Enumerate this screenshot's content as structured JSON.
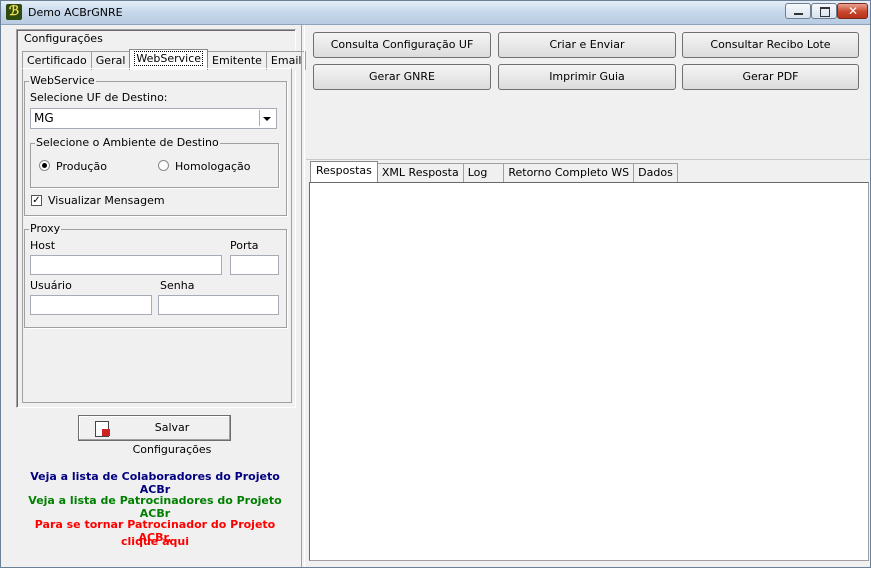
{
  "window": {
    "title": "Demo ACBrGNRE",
    "app_icon": "acbr-app-icon"
  },
  "config": {
    "legend": "Configurações",
    "tabs": [
      "Certificado",
      "Geral",
      "WebService",
      "Emitente",
      "Email"
    ],
    "active_tab": "WebService",
    "webservice": {
      "legend": "WebService",
      "uf_label": "Selecione UF de Destino:",
      "uf_value": "MG",
      "ambiente_legend": "Selecione o Ambiente de Destino",
      "producao_label": "Produção",
      "homologacao_label": "Homologação",
      "selected_ambiente": "Produção",
      "visualizar_label": "Visualizar Mensagem",
      "visualizar_checked": true
    },
    "proxy": {
      "legend": "Proxy",
      "host_label": "Host",
      "porta_label": "Porta",
      "usuario_label": "Usuário",
      "senha_label": "Senha",
      "host_value": "",
      "porta_value": "",
      "usuario_value": "",
      "senha_value": ""
    },
    "save_label": "Salvar Configurações"
  },
  "links": {
    "colaboradores": "Veja a lista de Colaboradores do Projeto ACBr",
    "patrocinadores": "Veja a lista de Patrocinadores do Projeto ACBr",
    "tornar_line1": "Para se tornar Patrocinador do Projeto ACBr,",
    "tornar_line2": "clique aqui",
    "colors": {
      "colaboradores": "#000080",
      "patrocinadores": "#008000",
      "tornar": "#ff0000"
    }
  },
  "actions": {
    "consulta_uf": "Consulta Configuração UF",
    "criar_enviar": "Criar e Enviar",
    "consultar_recibo": "Consultar Recibo Lote",
    "gerar_gnre": "Gerar GNRE",
    "imprimir_guia": "Imprimir Guia",
    "gerar_pdf": "Gerar PDF"
  },
  "response_tabs": [
    "Respostas",
    "XML Resposta",
    "Log",
    "Retorno Completo WS",
    "Dados"
  ],
  "active_response_tab": "Respostas"
}
